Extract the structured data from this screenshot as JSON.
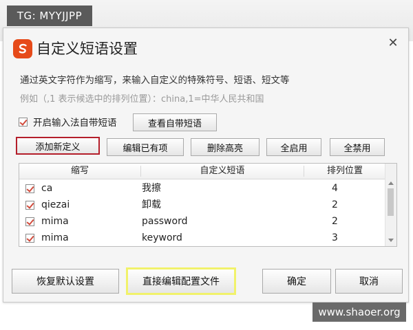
{
  "overlay": {
    "tg_badge": "TG: MYYJJPP",
    "site_watermark": "www.shaoer.org"
  },
  "dialog": {
    "title": "自定义短语设置",
    "close_glyph": "✕",
    "description": "通过英文字符作为缩写，来输入自定义的特殊符号、短语、短文等",
    "example": "例如（,1 表示候选中的排列位置）：china,1=中华人民共和国",
    "enable_builtin": {
      "label": "开启输入法自带短语",
      "checked": true
    },
    "view_builtin_button": "查看自带短语",
    "toolbar": {
      "add_new": "添加新定义",
      "edit_existing": "编辑已有项",
      "delete_highlight": "删除高亮",
      "enable_all": "全启用",
      "disable_all": "全禁用"
    },
    "table": {
      "headers": [
        "缩写",
        "自定义短语",
        "排列位置"
      ],
      "rows": [
        {
          "checked": true,
          "abbr": "ca",
          "phrase": "我擦",
          "position": "4"
        },
        {
          "checked": true,
          "abbr": "qiezai",
          "phrase": "卸载",
          "position": "2"
        },
        {
          "checked": true,
          "abbr": "mima",
          "phrase": "password",
          "position": "2"
        },
        {
          "checked": true,
          "abbr": "mima",
          "phrase": "keyword",
          "position": "3"
        }
      ]
    },
    "footer": {
      "restore_defaults": "恢复默认设置",
      "edit_config_file": "直接编辑配置文件",
      "ok": "确定",
      "cancel": "取消"
    }
  },
  "colors": {
    "logo": "#e64a19",
    "add_button_border": "#b41e2a",
    "config_button_border": "#f1f26a"
  }
}
